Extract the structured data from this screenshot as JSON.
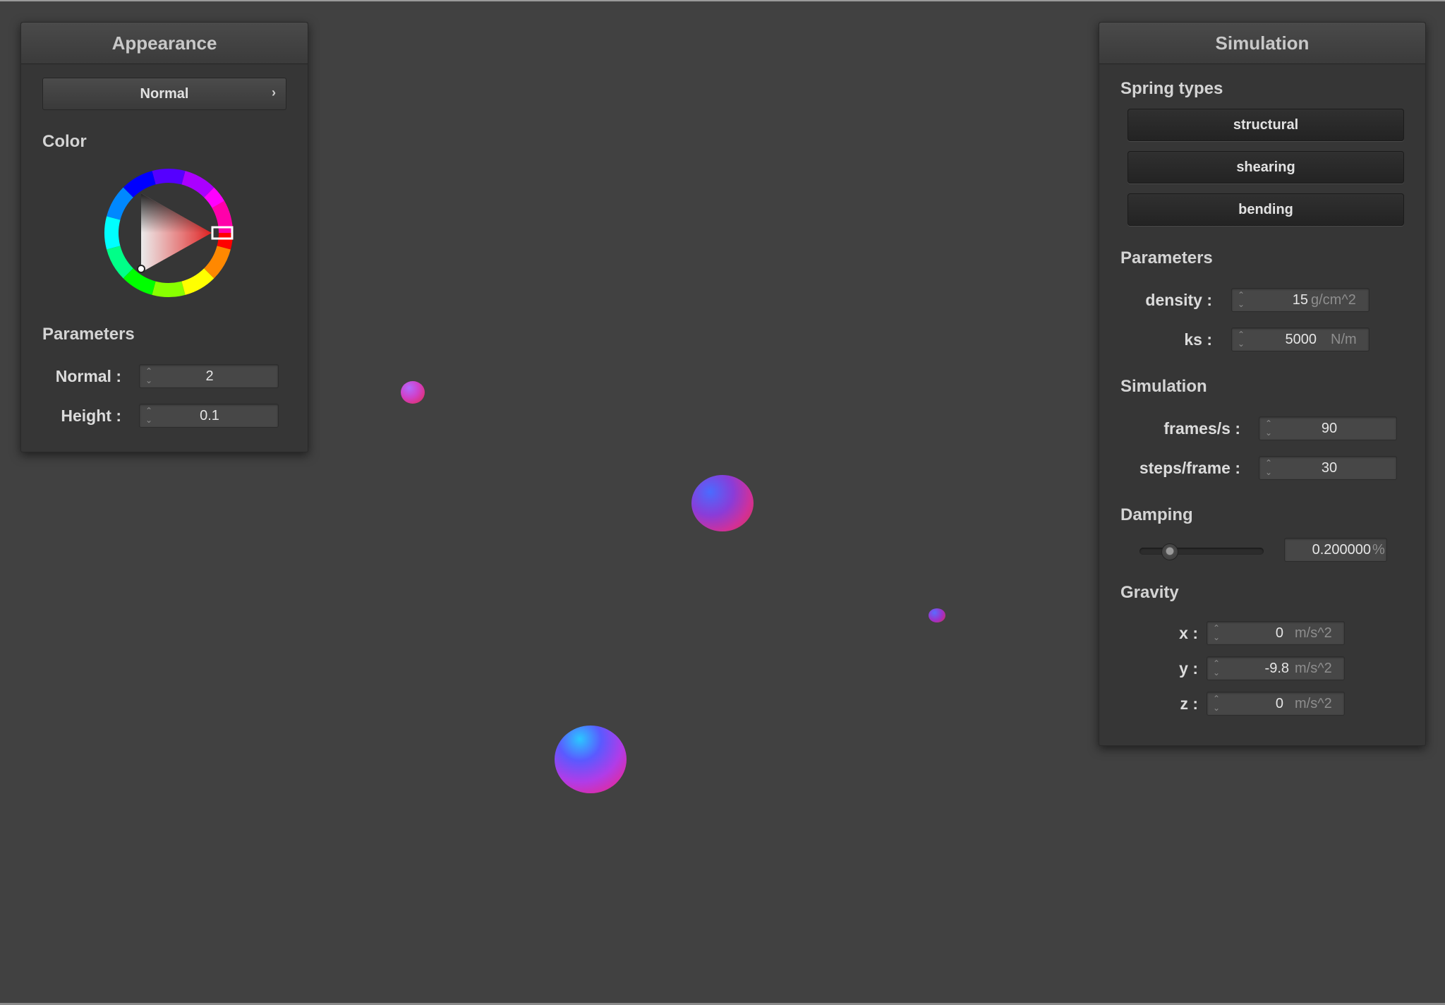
{
  "appearance": {
    "title": "Appearance",
    "mode_label": "Normal",
    "color_section": "Color",
    "color_value": "#e02020",
    "params_section": "Parameters",
    "normal_label": "Normal :",
    "normal_value": "2",
    "height_label": "Height :",
    "height_value": "0.1"
  },
  "simulation": {
    "title": "Simulation",
    "spring_section": "Spring types",
    "spring_buttons": [
      "structural",
      "shearing",
      "bending"
    ],
    "params_section": "Parameters",
    "density_label": "density :",
    "density_value": "15",
    "density_unit": "g/cm^2",
    "ks_label": "ks :",
    "ks_value": "5000",
    "ks_unit": "N/m",
    "sim_section": "Simulation",
    "fps_label": "frames/s :",
    "fps_value": "90",
    "steps_label": "steps/frame :",
    "steps_value": "30",
    "damping_section": "Damping",
    "damping_value": "0.200000",
    "damping_unit": "%",
    "damping_fraction": 0.2,
    "gravity_section": "Gravity",
    "gx_label": "x :",
    "gx_value": "0",
    "gy_label": "y :",
    "gy_value": "-9.8",
    "gz_label": "z :",
    "gz_value": "0",
    "gravity_unit": "m/s^2"
  },
  "icons": {
    "dropdown_chevron": "chevron-right-icon",
    "spin_arrows": "spin-arrows-icon"
  }
}
